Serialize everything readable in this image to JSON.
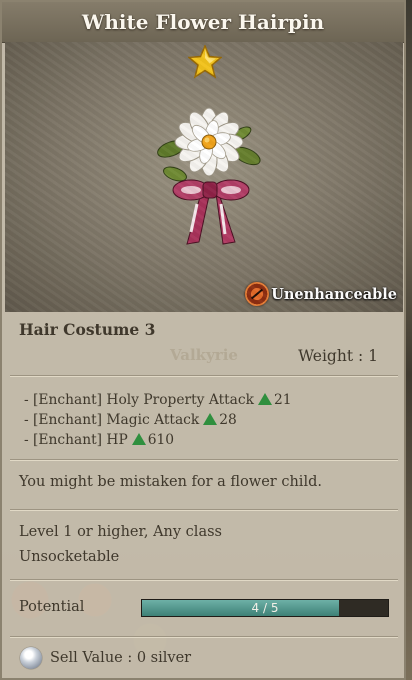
{
  "item": {
    "name": "White Flower Hairpin",
    "grade": "star-icon",
    "image": "white-flower-hairpin-icon",
    "enhance_status": "Unenhanceable",
    "type": "Hair Costume 3",
    "class_hint": "Valkyrie",
    "weight": "Weight : 1"
  },
  "enchants": [
    {
      "label": "- [Enchant] Holy Property Attack",
      "value": "21"
    },
    {
      "label": "- [Enchant] Magic Attack",
      "value": "28"
    },
    {
      "label": "- [Enchant] HP",
      "value": "610"
    }
  ],
  "description": "You might be mistaken for a flower child.",
  "requirements": {
    "level_class": "Level 1 or higher, Any class",
    "socket": "Unsocketable"
  },
  "potential": {
    "label": "Potential",
    "current": 4,
    "max": 5,
    "text": "4 / 5",
    "fraction": 0.8
  },
  "sell": {
    "text": "Sell Value : 0 silver"
  },
  "colors": {
    "increase_arrow": "#2f8f3e",
    "potential_fill": "#4f968b"
  }
}
